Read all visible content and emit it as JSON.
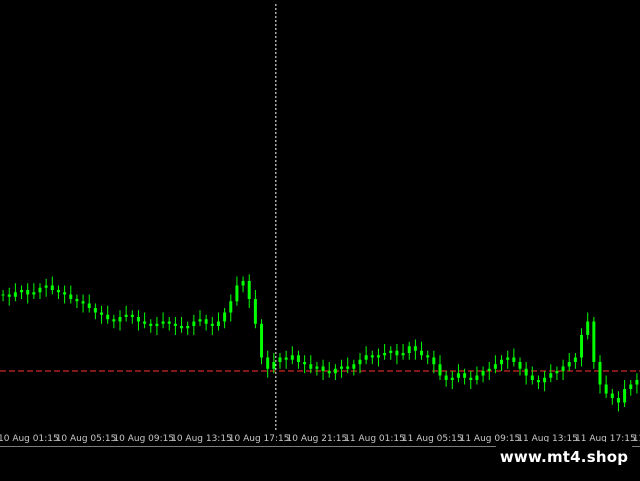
{
  "watermark": "www.mt4.shop",
  "colors": {
    "background": "#000000",
    "candle": "#00ff00",
    "price_line": "#ff3030",
    "crosshair": "#ffffff",
    "axis_text": "#c8c8c8"
  },
  "chart_data": {
    "type": "line",
    "title": "",
    "xlabel": "",
    "ylabel": "",
    "grid": false,
    "legend": "none",
    "time_ticks": [
      "10 Aug 01:15",
      "10 Aug 05:15",
      "10 Aug 09:15",
      "10 Aug 13:15",
      "10 Aug 17:15",
      "10 Aug 21:15",
      "11 Aug 01:15",
      "11 Aug 05:15",
      "11 Aug 09:15",
      "11 Aug 13:15",
      "11 Aug 17:15",
      "11"
    ],
    "ylim": [
      0,
      100
    ],
    "series": [
      {
        "values": [
          58,
          57,
          59,
          60,
          58,
          59,
          61,
          62,
          60,
          59,
          58,
          56,
          55,
          54,
          52,
          50,
          49,
          47,
          46,
          48,
          49,
          48,
          46,
          45,
          44,
          45,
          46,
          45,
          44,
          43,
          44,
          46,
          47,
          45,
          44,
          46,
          50,
          55,
          62,
          64,
          56,
          45,
          30,
          25,
          28,
          30,
          29,
          31,
          28,
          27,
          25,
          26,
          24,
          23,
          25,
          26,
          25,
          27,
          29,
          31,
          30,
          31,
          32,
          33,
          31,
          32,
          35,
          33,
          31,
          30,
          27,
          22,
          20,
          21,
          23,
          21,
          20,
          22,
          24,
          25,
          27,
          29,
          30,
          28,
          25,
          22,
          20,
          19,
          21,
          23,
          24,
          26,
          28,
          30,
          40,
          46,
          28,
          18,
          14,
          12,
          10,
          16,
          18,
          20
        ]
      }
    ],
    "current_price_level": 24,
    "crosshair_bar_index": 44
  }
}
